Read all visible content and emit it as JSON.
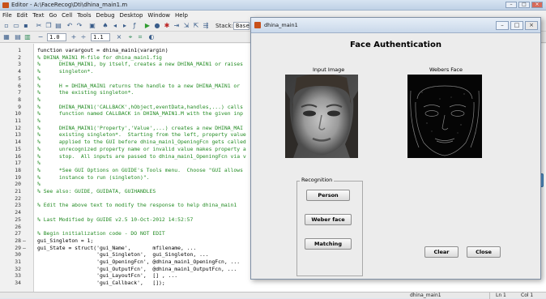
{
  "editor": {
    "title": "Editor - A:\\FaceRecog\\Dti\\dhina_main1.m",
    "menu": [
      "File",
      "Edit",
      "Text",
      "Go",
      "Cell",
      "Tools",
      "Debug",
      "Desktop",
      "Window",
      "Help"
    ],
    "toolbar": {
      "stack_label": "Stack:",
      "stack_value": "Base",
      "zoom_minus": "−",
      "cell_value_1": "1.0",
      "zoom_plus": "+",
      "divide": "÷",
      "cell_value_2": "1.1",
      "times": "×"
    },
    "code_lines": [
      {
        "n": "1",
        "bp": "",
        "text": "function varargout = dhina_main1(varargin)",
        "comment": false
      },
      {
        "n": "2",
        "bp": "",
        "text": "% DHINA_MAIN1 M-file for dhina_main1.fig",
        "comment": true
      },
      {
        "n": "3",
        "bp": "",
        "text": "%      DHINA_MAIN1, by itself, creates a new DHINA_MAIN1 or raises",
        "comment": true
      },
      {
        "n": "4",
        "bp": "",
        "text": "%      singleton*.",
        "comment": true
      },
      {
        "n": "5",
        "bp": "",
        "text": "%",
        "comment": true
      },
      {
        "n": "6",
        "bp": "",
        "text": "%      H = DHINA_MAIN1 returns the handle to a new DHINA_MAIN1 or",
        "comment": true
      },
      {
        "n": "7",
        "bp": "",
        "text": "%      the existing singleton*.",
        "comment": true
      },
      {
        "n": "8",
        "bp": "",
        "text": "%",
        "comment": true
      },
      {
        "n": "9",
        "bp": "",
        "text": "%      DHINA_MAIN1('CALLBACK',hObject,eventData,handles,...) calls",
        "comment": true
      },
      {
        "n": "10",
        "bp": "",
        "text": "%      function named CALLBACK in DHINA_MAIN1.M with the given inp",
        "comment": true
      },
      {
        "n": "11",
        "bp": "",
        "text": "%",
        "comment": true
      },
      {
        "n": "12",
        "bp": "",
        "text": "%      DHINA_MAIN1('Property','Value',...) creates a new DHINA_MAI",
        "comment": true
      },
      {
        "n": "13",
        "bp": "",
        "text": "%      existing singleton*.  Starting from the left, property value",
        "comment": true
      },
      {
        "n": "14",
        "bp": "",
        "text": "%      applied to the GUI before dhina_main1_OpeningFcn gets called",
        "comment": true
      },
      {
        "n": "15",
        "bp": "",
        "text": "%      unrecognized property name or invalid value makes property a",
        "comment": true
      },
      {
        "n": "16",
        "bp": "",
        "text": "%      stop.  All inputs are passed to dhina_main1_OpeningFcn via v",
        "comment": true
      },
      {
        "n": "17",
        "bp": "",
        "text": "%",
        "comment": true
      },
      {
        "n": "18",
        "bp": "",
        "text": "%      *See GUI Options on GUIDE's Tools menu.  Choose \"GUI allows",
        "comment": true
      },
      {
        "n": "19",
        "bp": "",
        "text": "%      instance to run (singleton)\".",
        "comment": true
      },
      {
        "n": "20",
        "bp": "",
        "text": "%",
        "comment": true
      },
      {
        "n": "21",
        "bp": "",
        "text": "% See also: GUIDE, GUIDATA, GUIHANDLES",
        "comment": true
      },
      {
        "n": "22",
        "bp": "",
        "text": "",
        "comment": false
      },
      {
        "n": "23",
        "bp": "",
        "text": "% Edit the above text to modify the response to help dhina_main1",
        "comment": true
      },
      {
        "n": "24",
        "bp": "",
        "text": "",
        "comment": false
      },
      {
        "n": "25",
        "bp": "",
        "text": "% Last Modified by GUIDE v2.5 10-Oct-2012 14:52:57",
        "comment": true
      },
      {
        "n": "26",
        "bp": "",
        "text": "",
        "comment": false
      },
      {
        "n": "27",
        "bp": "",
        "text": "% Begin initialization code - DO NOT EDIT",
        "comment": true
      },
      {
        "n": "28",
        "bp": "–",
        "text": "gui_Singleton = 1;",
        "comment": false
      },
      {
        "n": "29",
        "bp": "–",
        "text": "gui_State = struct('gui_Name',       mfilename, ...",
        "comment": false
      },
      {
        "n": "30",
        "bp": "",
        "text": "                   'gui_Singleton',  gui_Singleton, ...",
        "comment": false
      },
      {
        "n": "31",
        "bp": "",
        "text": "                   'gui_OpeningFcn', @dhina_main1_OpeningFcn, ...",
        "comment": false
      },
      {
        "n": "32",
        "bp": "",
        "text": "                   'gui_OutputFcn',  @dhina_main1_OutputFcn, ...",
        "comment": false
      },
      {
        "n": "33",
        "bp": "",
        "text": "                   'gui_LayoutFcn',  [] , ...",
        "comment": false
      },
      {
        "n": "34",
        "bp": "",
        "text": "                   'gui_Callback',   []);",
        "comment": false
      }
    ],
    "status": {
      "file": "dhina_main1",
      "ln": "Ln  1",
      "col": "Col  1"
    }
  },
  "figure": {
    "window_title": "dhina_main1",
    "heading": "Face Authentication",
    "input_label": "Input Image",
    "webers_label": "Webers Face",
    "recognition_label": "Recognition",
    "buttons": {
      "person": "Person",
      "weber": "Weber face",
      "matching": "Matching",
      "clear": "Clear",
      "close": "Close"
    }
  },
  "colors": {
    "comment": "#228b22",
    "title_gradient_top": "#d7e4f2",
    "figure_bg": "#ececec"
  }
}
